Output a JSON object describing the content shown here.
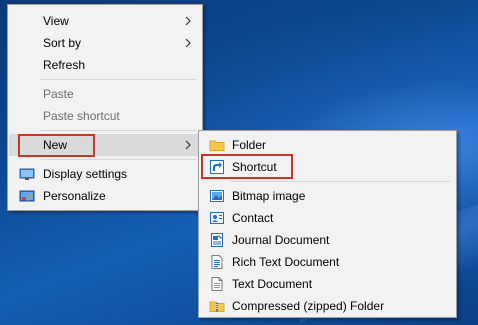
{
  "context_menu": {
    "items": [
      {
        "label": "View",
        "has_submenu": true
      },
      {
        "label": "Sort by",
        "has_submenu": true
      },
      {
        "label": "Refresh"
      },
      {
        "label": "Paste",
        "disabled": true
      },
      {
        "label": "Paste shortcut",
        "disabled": true
      },
      {
        "label": "New",
        "has_submenu": true,
        "highlighted": true
      },
      {
        "label": "Display settings",
        "icon": "display-icon"
      },
      {
        "label": "Personalize",
        "icon": "personalize-icon"
      }
    ]
  },
  "new_submenu": {
    "items": [
      {
        "label": "Folder",
        "icon": "folder-icon"
      },
      {
        "label": "Shortcut",
        "icon": "shortcut-icon",
        "highlighted": true
      },
      {
        "label": "Bitmap image",
        "icon": "bitmap-icon"
      },
      {
        "label": "Contact",
        "icon": "contact-icon"
      },
      {
        "label": "Journal Document",
        "icon": "journal-icon"
      },
      {
        "label": "Rich Text Document",
        "icon": "rich-text-icon"
      },
      {
        "label": "Text Document",
        "icon": "text-document-icon"
      },
      {
        "label": "Compressed (zipped) Folder",
        "icon": "zip-folder-icon"
      }
    ]
  },
  "colors": {
    "menu_background": "#f2f2f2",
    "hover": "#dadada",
    "disabled_text": "#6d6d6d",
    "annotation_outline": "#c0392b",
    "desktop": "#0d4a93"
  }
}
